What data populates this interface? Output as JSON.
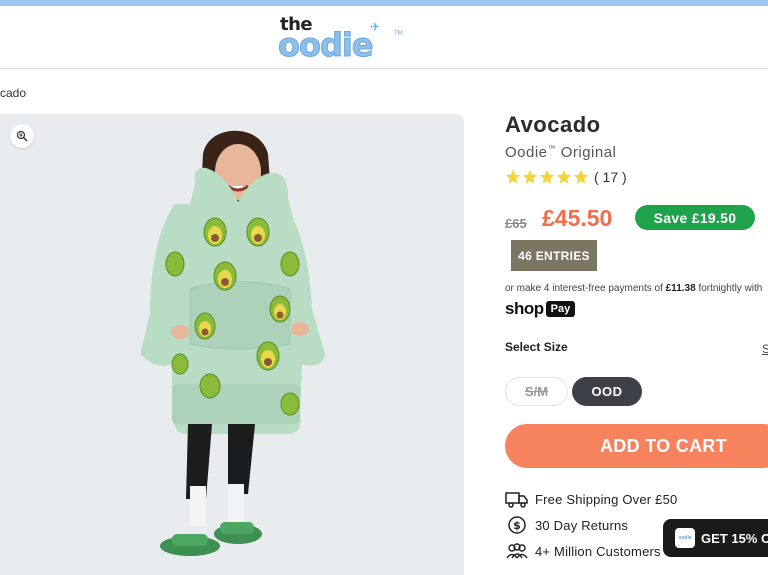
{
  "header": {
    "logo_the": "the",
    "logo_oodie": "oodie",
    "logo_tm": "TM"
  },
  "breadcrumb": {
    "text": "cado"
  },
  "product": {
    "title": "Avocado",
    "subtitle": "Oodie",
    "subtitle_tm": "™",
    "subtitle_suffix": " Original",
    "rating": 5,
    "reviews": "( 17 )",
    "old_price": "£65",
    "price": "£45.50",
    "save_badge": "Save £19.50",
    "entries_badge": "46 ENTRIES",
    "installments_prefix": "or make 4 interest-free payments of ",
    "installments_amount": "£11.38",
    "installments_suffix": " fortnightly with",
    "shoppay_shop": "shop",
    "shoppay_pay": "Pay"
  },
  "size": {
    "label": "Select Size",
    "guide_edge": "S",
    "options": [
      {
        "label": "S/M",
        "available": false
      },
      {
        "label": "OOD",
        "available": true,
        "selected": true
      }
    ]
  },
  "cart": {
    "add_label": "ADD TO CART"
  },
  "features": [
    {
      "icon": "truck-icon",
      "label": "Free Shipping Over £50"
    },
    {
      "icon": "dollar-return-icon",
      "label": "30 Day Returns"
    },
    {
      "icon": "people-icon",
      "label": "4+ Million Customers"
    }
  ],
  "promo": {
    "label": "GET 15% O",
    "icon_text": "oodie"
  },
  "colors": {
    "accent": "#f7825e",
    "price": "#f26b4a",
    "save_green": "#1fa34a",
    "brand_blue": "#8dbfec",
    "oodie_green": "#b8dcc4"
  }
}
